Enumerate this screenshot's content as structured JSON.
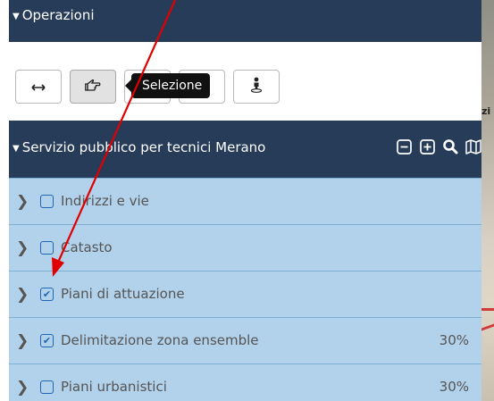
{
  "map": {
    "label_fragment": "zi"
  },
  "operations": {
    "title": "Operazioni"
  },
  "toolbar": {
    "buttons": [
      {
        "name": "pan-horizontal",
        "icon": "horizontal-arrows-icon",
        "glyph": "⟷"
      },
      {
        "name": "select",
        "icon": "pointing-hand-icon",
        "glyph": "☜",
        "active": true
      },
      {
        "name": "info",
        "icon": "info-icon",
        "glyph": ""
      },
      {
        "name": "measure",
        "icon": "ruler-icon",
        "glyph": ""
      },
      {
        "name": "street-view",
        "icon": "person-pin-icon",
        "glyph": "♙"
      }
    ],
    "tooltip": "Selezione"
  },
  "service": {
    "title": "Servizio pubblico per tecnici Merano",
    "icons": [
      "collapse-all-icon",
      "expand-all-icon",
      "search-icon",
      "map-icon"
    ]
  },
  "layers": [
    {
      "label": "Indirizzi e vie",
      "checked": false,
      "percent": ""
    },
    {
      "label": "Catasto",
      "checked": false,
      "percent": ""
    },
    {
      "label": "Piani di attuazione",
      "checked": true,
      "percent": ""
    },
    {
      "label": "Delimitazione zona ensemble",
      "checked": true,
      "percent": "30%"
    },
    {
      "label": "Piani urbanistici",
      "checked": false,
      "percent": "30%"
    }
  ],
  "colors": {
    "header_bg": "#263c59",
    "layer_bg": "#b2d1ea",
    "checkbox_blue": "#1f66b5",
    "annotation_arrow": "#e00000"
  }
}
